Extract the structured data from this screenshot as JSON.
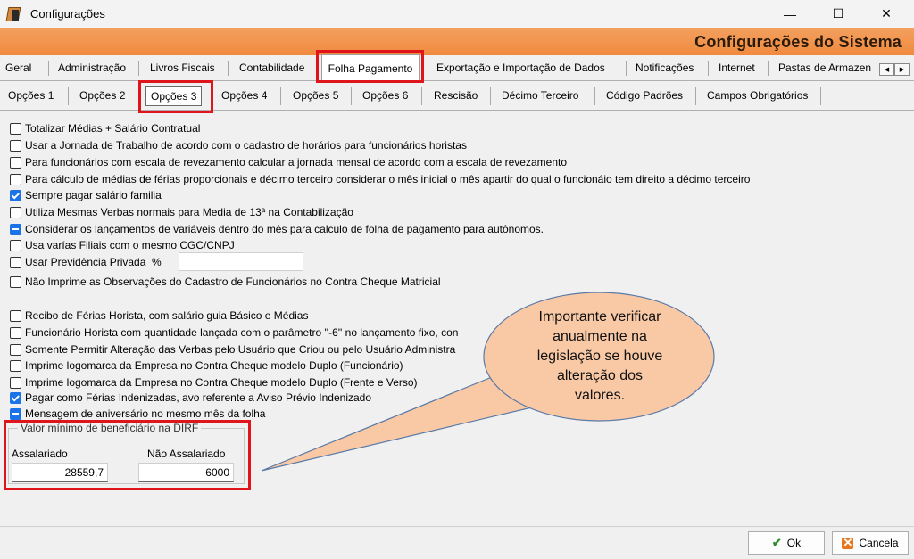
{
  "window": {
    "title": "Configurações",
    "minimize": "—",
    "maximize": "☐",
    "close": "✕"
  },
  "banner": {
    "title": "Configurações do Sistema"
  },
  "main_tabs": [
    "Geral",
    "Administração",
    "Livros Fiscais",
    "Contabilidade",
    "Folha Pagamento",
    "Exportação e Importação de Dados",
    "Notificações",
    "Internet",
    "Pastas de Armazen"
  ],
  "main_tabs_active": "Folha Pagamento",
  "sub_tabs": [
    "Opções 1",
    "Opções 2",
    "Opções 3",
    "Opções 4",
    "Opções 5",
    "Opções 6",
    "Rescisão",
    "Décimo Terceiro",
    "Código Padrões",
    "Campos Obrigatórios"
  ],
  "sub_tabs_active": "Opções 3",
  "options": [
    {
      "label": "Totalizar Médias + Salário Contratual",
      "state": "unchecked"
    },
    {
      "label": "Usar a Jornada de Trabalho de acordo com o cadastro de horários para funcionários horistas",
      "state": "unchecked"
    },
    {
      "label": "Para funcionários com escala de revezamento calcular a jornada mensal de acordo com a escala de revezamento",
      "state": "unchecked"
    },
    {
      "label": "Para cálculo de médias de férias proporcionais e décimo terceiro considerar o mês inicial o mês apartir do qual o funcionáio tem direito a décimo terceiro",
      "state": "unchecked"
    },
    {
      "label": "Sempre pagar salário familia",
      "state": "checked"
    },
    {
      "label": "Utiliza Mesmas Verbas normais para Media de 13ª na Contabilização",
      "state": "unchecked"
    },
    {
      "label": "Considerar os lançamentos de variáveis dentro do mês para calculo de folha de pagamento para autônomos.",
      "state": "indeterminate"
    },
    {
      "label": "Usa varías Filiais com o mesmo CGC/CNPJ",
      "state": "unchecked"
    },
    {
      "label": "Usar Previdência Privada  %",
      "state": "unchecked"
    },
    {
      "label": "Não Imprime as Observações do Cadastro de Funcionários no Contra Cheque Matricial",
      "state": "unchecked"
    }
  ],
  "options2": [
    {
      "label": "Recibo de Férias Horista, com salário guia Básico e Médias",
      "state": "unchecked"
    },
    {
      "label": "Funcionário Horista com quantidade lançada com o parâmetro ''-6'' no lançamento fixo, con",
      "state": "unchecked"
    },
    {
      "label": "Somente Permitir Alteração das Verbas pelo Usuário que Criou ou pelo Usuário Administra",
      "state": "unchecked"
    },
    {
      "label": "Imprime logomarca da Empresa no Contra Cheque modelo Duplo (Funcionário)",
      "state": "unchecked"
    },
    {
      "label": "Imprime logomarca da Empresa no Contra Cheque modelo Duplo (Frente e Verso)",
      "state": "unchecked"
    },
    {
      "label": "Pagar como Férias Indenizadas, avo referente a Aviso Prévio Indenizado",
      "state": "checked"
    },
    {
      "label": "Mensagem de aniversário no mesmo mês da folha",
      "state": "indeterminate"
    }
  ],
  "dirf": {
    "legend": "Valor mínimo de beneficiário na DIRF",
    "assalariado_label": "Assalariado",
    "assalariado_value": "28559,7",
    "nao_assalariado_label": "Não Assalariado",
    "nao_assalariado_value": "6000"
  },
  "callout": {
    "lines": [
      "Importante verificar",
      "anualmente na",
      "legislação se houve",
      "alteração dos",
      "valores."
    ]
  },
  "buttons": {
    "ok": "Ok",
    "cancel": "Cancela"
  },
  "colors": {
    "banner": "#f18a3e",
    "highlight": "#e0141b",
    "callout_fill": "#f9c9a6",
    "checkbox_checked": "#1a73e8"
  }
}
